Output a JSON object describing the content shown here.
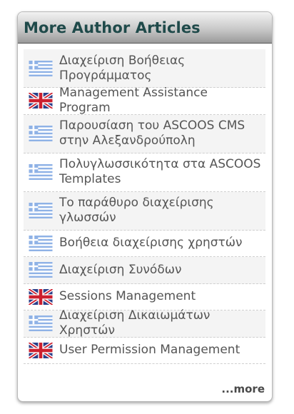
{
  "panel": {
    "title": "More Author Articles",
    "more_label": "...more"
  },
  "articles": [
    {
      "lang": "greek-flag-icon",
      "text": "Διαχείριση Βοήθειας Προγράμματος"
    },
    {
      "lang": "uk-flag-icon",
      "text": "Management Assistance Program"
    },
    {
      "lang": "greek-flag-icon",
      "text": "Παρουσίαση του ASCOOS CMS στην Αλεξανδρούπολη"
    },
    {
      "lang": "greek-flag-icon",
      "text": "Πολυγλωσσικότητα στα ASCOOS Templates"
    },
    {
      "lang": "greek-flag-icon",
      "text": "Το παράθυρο διαχείρισης γλωσσών"
    },
    {
      "lang": "greek-flag-icon",
      "text": "Βοήθεια διαχείρισης χρηστών"
    },
    {
      "lang": "greek-flag-icon",
      "text": "Διαχείριση Συνόδων"
    },
    {
      "lang": "uk-flag-icon",
      "text": "Sessions Management"
    },
    {
      "lang": "greek-flag-icon",
      "text": "Διαχείριση Δικαιωμάτων Χρηστών"
    },
    {
      "lang": "uk-flag-icon",
      "text": "User Permission Management"
    }
  ]
}
